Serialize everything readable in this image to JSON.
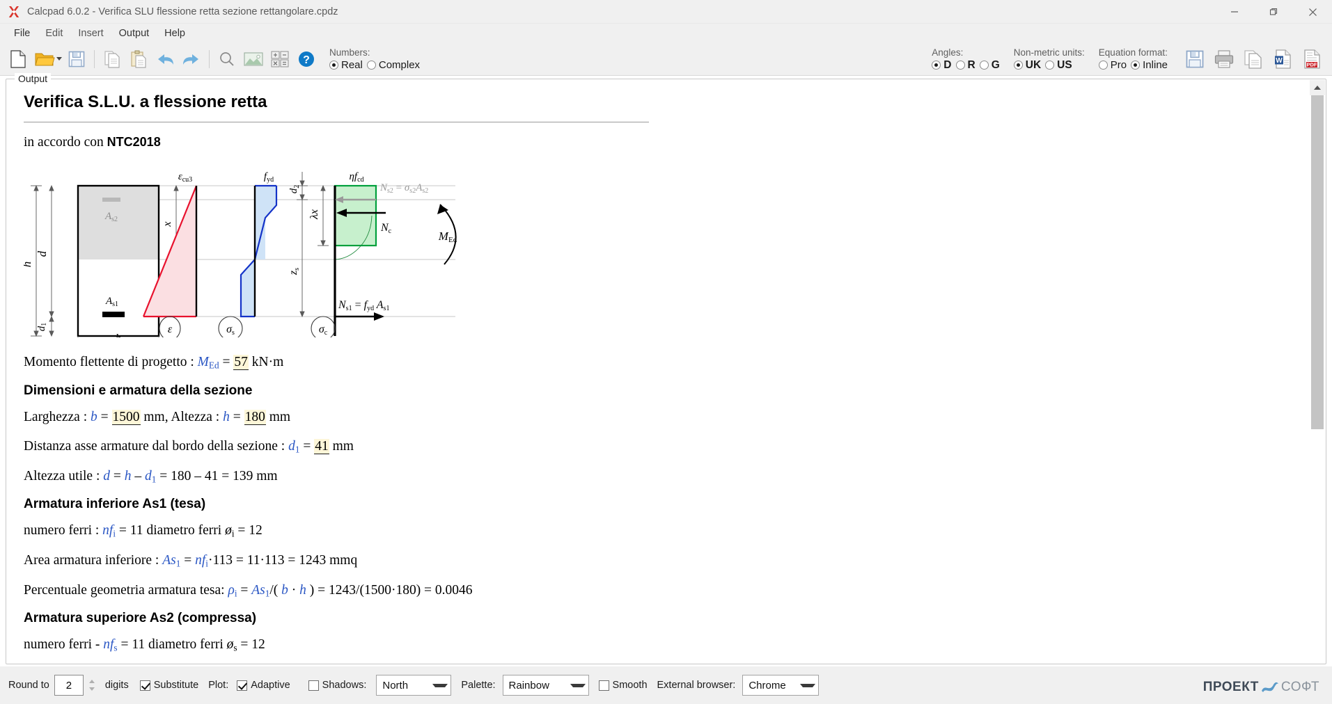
{
  "window": {
    "title": "Calcpad 6.0.2 - Verifica SLU flessione retta sezione rettangolare.cpdz",
    "minimize": "–",
    "maximize": "❐",
    "close": "✕"
  },
  "menubar": {
    "items": [
      {
        "label": "File"
      },
      {
        "label": "Edit"
      },
      {
        "label": "Insert"
      },
      {
        "label": "Output"
      },
      {
        "label": "Help"
      }
    ]
  },
  "toolbar": {
    "buttons": [
      {
        "name": "new-file",
        "tip": "New"
      },
      {
        "name": "open-file",
        "tip": "Open"
      },
      {
        "name": "save-file",
        "tip": "Save"
      },
      {
        "name": "copy",
        "tip": "Copy"
      },
      {
        "name": "paste",
        "tip": "Paste"
      },
      {
        "name": "undo",
        "tip": "Undo"
      },
      {
        "name": "redo",
        "tip": "Redo"
      },
      {
        "name": "find",
        "tip": "Find"
      },
      {
        "name": "insert-image",
        "tip": "Image"
      },
      {
        "name": "calculator",
        "tip": "Calculator"
      },
      {
        "name": "help",
        "tip": "Help"
      }
    ],
    "numbers": {
      "label": "Numbers:",
      "options": [
        {
          "label": "Real",
          "selected": true
        },
        {
          "label": "Complex",
          "selected": false
        }
      ]
    },
    "angles": {
      "label": "Angles:",
      "options": [
        {
          "label": "D",
          "selected": true
        },
        {
          "label": "R",
          "selected": false
        },
        {
          "label": "G",
          "selected": false
        }
      ]
    },
    "units": {
      "label": "Non-metric units:",
      "options": [
        {
          "label": "UK",
          "selected": true
        },
        {
          "label": "US",
          "selected": false
        }
      ]
    },
    "equation_format": {
      "label": "Equation format:",
      "options": [
        {
          "label": "Pro",
          "selected": false
        },
        {
          "label": "Inline",
          "selected": true
        }
      ]
    },
    "run_button": "play-icon",
    "export_buttons": [
      {
        "name": "save-output",
        "label": "Save"
      },
      {
        "name": "print",
        "label": "Print"
      },
      {
        "name": "copy-output",
        "label": "Copy"
      },
      {
        "name": "export-word",
        "label": "W"
      },
      {
        "name": "export-pdf",
        "label": "PDF"
      }
    ]
  },
  "output": {
    "legend": "Output",
    "title": "Verifica S.L.U. a flessione retta",
    "subtitle_prefix": "in accordo con ",
    "subtitle_bold": "NTC2018",
    "diagram": {
      "labels": {
        "h": "h",
        "d": "d",
        "d1": "d",
        "d1_sub": "1",
        "b": "b",
        "as2": "A",
        "as2_sub": "s2",
        "as1": "A",
        "as1_sub": "s1",
        "x": "x",
        "eps_cu3": "ε",
        "eps_cu3_sub": "cu3",
        "f_yd": "f",
        "f_yd_sub": "yd",
        "eta_f_cd": "ηf",
        "eta_f_cd_sub": "cd",
        "d2": "d",
        "d2_sub": "2",
        "lambda_x": "λx",
        "z_s": "z",
        "z_s_sub": "s",
        "Ns2": "N",
        "Ns2_eq": "= σ",
        "Nc": "N",
        "Nc_sub": "c",
        "Med": "M",
        "Med_sub": "Ed",
        "Ns1": "N",
        "Ns1_sub": "s1",
        "circle_eps": "ε",
        "circle_sigma_s": "σ",
        "circle_sigma_s_sub": "s",
        "circle_sigma_c": "σ",
        "circle_sigma_c_sub": "c"
      }
    },
    "lines": [
      {
        "id": "momento",
        "type": "paragraph",
        "text": "Momento flettente di progetto :  M_Ed = 57 kN·m",
        "value": "57",
        "unit": "kN·m"
      },
      {
        "id": "dim-heading",
        "type": "heading",
        "text": "Dimensioni e armatura della sezione"
      },
      {
        "id": "larghezza",
        "type": "paragraph",
        "text": "Larghezza :  b = 1500 mm, Altezza :  h = 180 mm",
        "b": "1500",
        "h": "180"
      },
      {
        "id": "distanza",
        "type": "paragraph",
        "text": "Distanza asse armature dal bordo della sezione :  d1 = 41 mm",
        "d1": "41"
      },
      {
        "id": "altezza-utile",
        "type": "paragraph",
        "text": "Altezza utile :  d = h − d1 = 180 − 41 = 139 mm",
        "result": "139"
      },
      {
        "id": "as1-heading",
        "type": "heading",
        "text": "Armatura inferiore As1 (tesa)"
      },
      {
        "id": "numero-ferri-i",
        "type": "paragraph",
        "text": "numero ferri :  nf_i = 11 diametro ferri ø_i = 12",
        "nf": "11",
        "diam": "12"
      },
      {
        "id": "area-inferiore",
        "type": "paragraph",
        "text": "Area armatura inferiore :  As1 = nf_i·113 = 11·113 = 1243 mmq",
        "result": "1243"
      },
      {
        "id": "percentuale",
        "type": "paragraph",
        "text": "Percentuale geometria armatura tesa: ρ_i = As1/(b·h) = 1243/(1500·180) = 0.0046",
        "result": "0.0046"
      },
      {
        "id": "as2-heading",
        "type": "heading",
        "text": "Armatura superiore As2 (compressa)"
      },
      {
        "id": "numero-ferri-s",
        "type": "paragraph",
        "text": "numero ferri - nf_s = 11 diametro ferri ø_s = 12",
        "nf": "11",
        "diam": "12"
      }
    ],
    "text": {
      "momento_label": "Momento flettente di progetto :",
      "momento_var": "M",
      "momento_sub": "Ed",
      "momento_eq": " = ",
      "momento_value": "57",
      "momento_unit": " kN·m",
      "dim_heading": "Dimensioni e armatura della sezione",
      "larghezza_label": "Larghezza :",
      "larghezza_var": "b",
      "larghezza_value": "1500",
      "larghezza_unit": " mm, ",
      "altezza_label": "Altezza :",
      "altezza_var": "h",
      "altezza_value": "180",
      "altezza_unit": " mm",
      "distanza_label": "Distanza asse armature dal bordo della sezione :",
      "distanza_var": "d",
      "distanza_sub": "1",
      "distanza_value": "41",
      "distanza_unit": " mm",
      "utile_label": "Altezza utile :",
      "utile_expr": " = 180 – 41 = 139 mm",
      "as1_heading": "Armatura inferiore As1 (tesa)",
      "ferri_label": "numero ferri :",
      "ferri_nf": "nf",
      "ferri_nf_sub": "i",
      "ferri_count": " = 11 ",
      "ferri_diam_label": "diametro ferri ",
      "ferri_diam_var": "ø",
      "ferri_diam_sub": "i",
      "ferri_diam_val": " = 12",
      "area_label": "Area armatura inferiore :",
      "area_expr": "·113 = 11·113 = 1243 mmq",
      "perc_label": "Percentuale geometria armatura tesa:",
      "perc_expr": "/( b · h ) = 1243/(1500·180) = 0.0046",
      "as2_heading": "Armatura superiore As2 (compressa)",
      "ferri2_label": "numero ferri - ",
      "ferri2_nf": "nf",
      "ferri2_nf_sub": "s",
      "ferri2_count": " = 11 ",
      "ferri2_diam_var": "ø",
      "ferri2_diam_sub": "s",
      "ferri2_diam_val": " = 12"
    }
  },
  "statusbar": {
    "round_to_label": "Round to",
    "round_to_value": "2",
    "digits_label": "digits",
    "substitute_label": "Substitute",
    "substitute_checked": true,
    "plot_label": "Plot:",
    "adaptive_label": "Adaptive",
    "adaptive_checked": true,
    "shadows_label": "Shadows:",
    "shadows_checked": false,
    "shadows_value": "North",
    "palette_label": "Palette:",
    "palette_value": "Rainbow",
    "smooth_label": "Smooth",
    "smooth_checked": false,
    "external_browser_label": "External browser:",
    "external_browser_value": "Chrome",
    "logo_bold": "ПРОЕКТ",
    "logo_light": "СОФТ"
  },
  "colors": {
    "accent": "#2b57c4",
    "highlight": "#fdf6d8",
    "strain_red": "#e8112d",
    "stress_blue": "#1433c8",
    "concrete_green": "#00a03c",
    "chrome": "#f0f0f0",
    "play_yellow": "#fbbd08"
  }
}
